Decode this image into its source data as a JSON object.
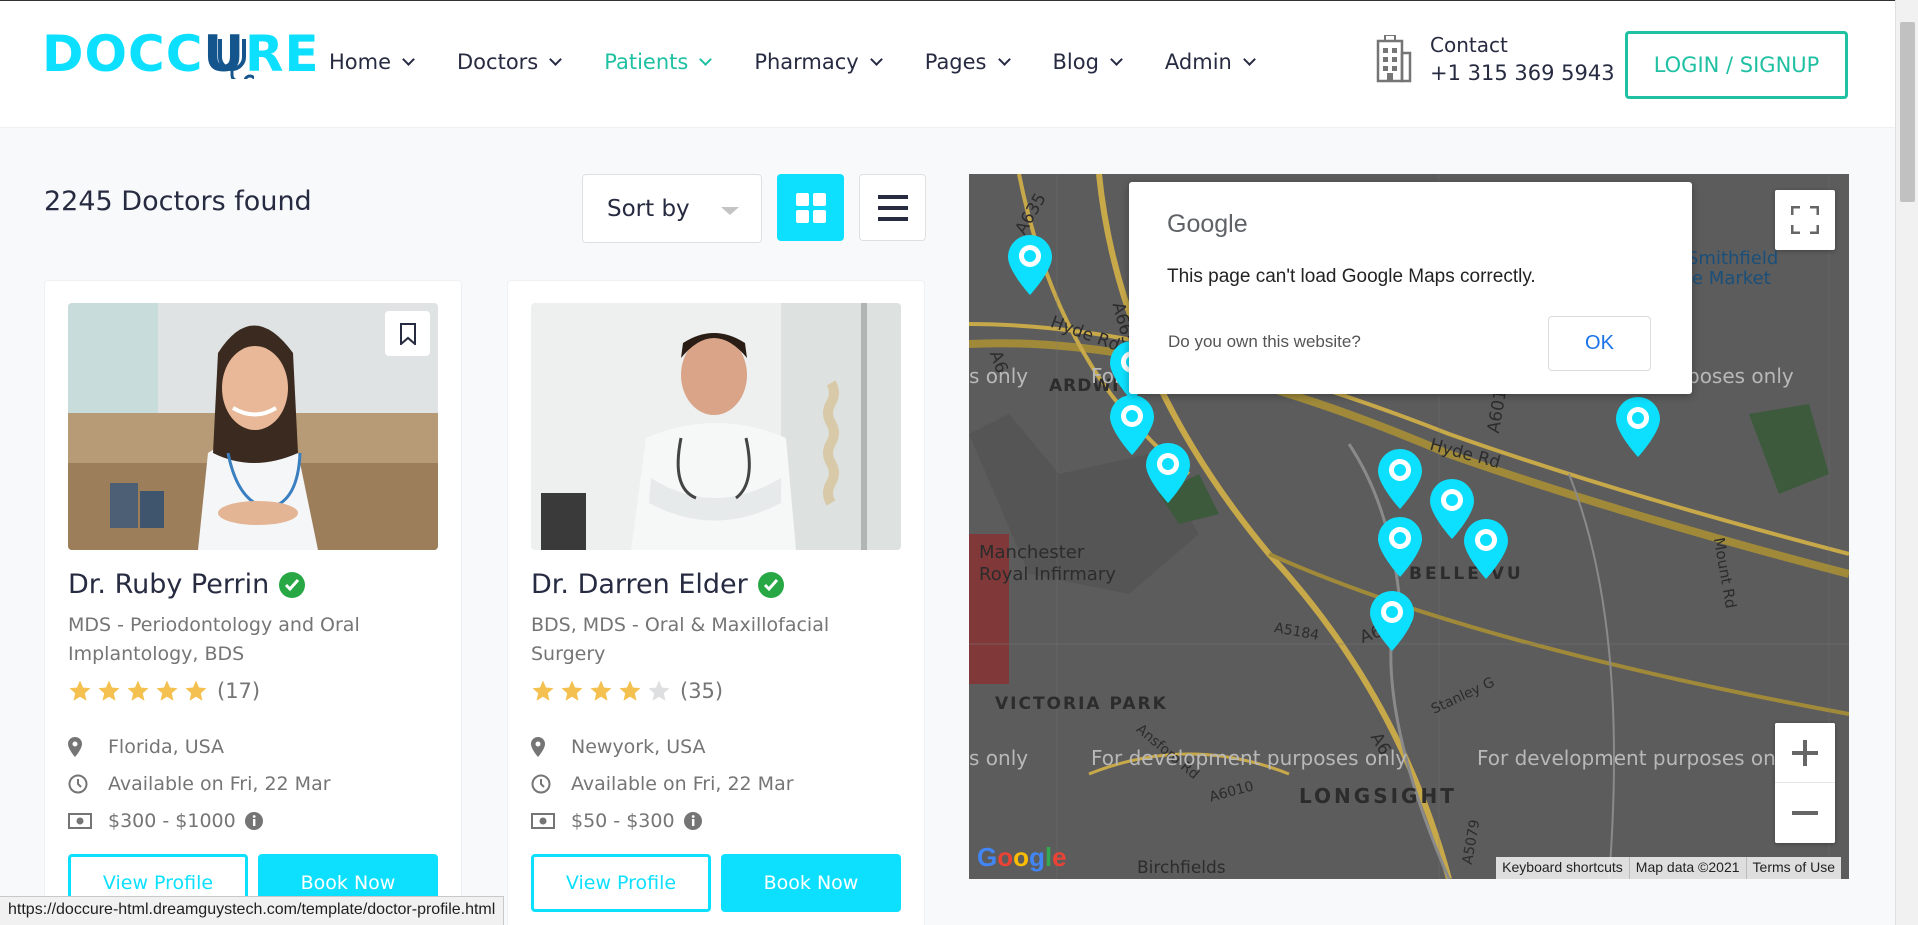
{
  "header": {
    "logo_part1": "DOCC",
    "logo_part2": "U",
    "logo_part3": "RE",
    "nav": [
      {
        "label": "Home",
        "active": false
      },
      {
        "label": "Doctors",
        "active": false
      },
      {
        "label": "Patients",
        "active": true
      },
      {
        "label": "Pharmacy",
        "active": false
      },
      {
        "label": "Pages",
        "active": false
      },
      {
        "label": "Blog",
        "active": false
      },
      {
        "label": "Admin",
        "active": false
      }
    ],
    "contact_label": "Contact",
    "contact_phone": "+1 315 369 5943",
    "login_label": "LOGIN / SIGNUP"
  },
  "results": {
    "count_text": "2245 Doctors found",
    "sort_label": "Sort by"
  },
  "doctors": [
    {
      "name": "Dr. Ruby Perrin",
      "specialty": "MDS - Periodontology and Oral Implantology, BDS",
      "rating": 5,
      "reviews": "(17)",
      "location": "Florida, USA",
      "availability": "Available on Fri, 22 Mar",
      "price": "$300 - $1000",
      "view_label": "View Profile",
      "book_label": "Book Now"
    },
    {
      "name": "Dr. Darren Elder",
      "specialty": "BDS, MDS - Oral & Maxillofacial Surgery",
      "rating": 4,
      "reviews": "(35)",
      "location": "Newyork, USA",
      "availability": "Available on Fri, 22 Mar",
      "price": "$50 - $300",
      "view_label": "View Profile",
      "book_label": "Book Now"
    }
  ],
  "map": {
    "dialog_brand": "Google",
    "dialog_message": "This page can't load Google Maps correctly.",
    "dialog_question": "Do you own this website?",
    "dialog_ok": "OK",
    "dev_text": "For development purposes only",
    "dev_text_left": "s only",
    "dev_text_cut": "For development purposes on",
    "dev_text_top_left": "For",
    "dev_text_top_right": "poses only",
    "labels": {
      "a635": "A635",
      "a665": "A665",
      "hyde_rd_1": "Hyde Rd",
      "hyde_rd_2": "Hyde Rd",
      "a6": "A6",
      "ardwick": "ARDWIC",
      "a6010_top": "A6010",
      "smithfield": "Smithfield",
      "market": "le Market",
      "manchester": "Manchester",
      "royal_infirmary": "Royal Infirmary",
      "belle_vue": "BELLE VU",
      "a5184": "A5184",
      "a6010_mid": "A6010",
      "mount_rd": "Mount Rd",
      "victoria_park": "VICTORIA PARK",
      "stanley": "Stanley G",
      "ansford": "Ansford Rd",
      "a6010_low": "A6010",
      "longsight": "LONGSIGHT",
      "a6_low": "A6",
      "a5079": "A5079",
      "birchfields": "Birchfields"
    },
    "google_logo": "Google",
    "footer": [
      "Keyboard shortcuts",
      "Map data ©2021",
      "Terms of Use"
    ]
  },
  "statusbar_url": "https://doccure-html.dreamguystech.com/template/doctor-profile.html",
  "colors": {
    "primary_cyan": "#0de0fe",
    "accent_green": "#20c0a3",
    "logo_blue": "#15558d",
    "star_gold": "#f4c150",
    "verified_green": "#28a745"
  }
}
